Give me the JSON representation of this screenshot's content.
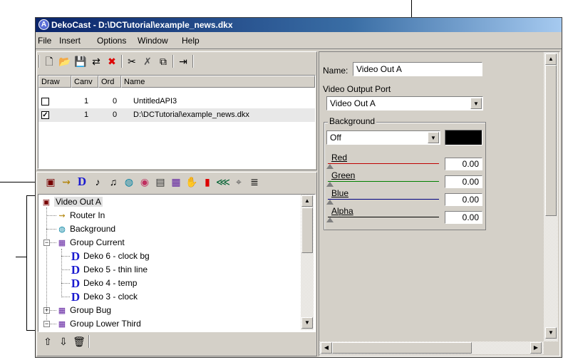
{
  "window": {
    "title": "DekoCast - D:\\DCTutorial\\example_news.dkx",
    "app_icon": "A"
  },
  "menu": {
    "items": [
      "File",
      "Insert",
      "Options",
      "Window",
      "Help"
    ]
  },
  "toolbar": {
    "icons": [
      "new-icon",
      "open-icon",
      "save-icon",
      "save-all-icon",
      "close-icon",
      "cut-icon",
      "delete-icon",
      "copy-icon",
      "export-icon"
    ],
    "glyphs": [
      "🗋",
      "📂",
      "💾",
      "⇄",
      "✖",
      "✂",
      "✗",
      "⧉",
      "⇥"
    ]
  },
  "canvas_list": {
    "headers": [
      "Draw",
      "Canv",
      "Ord",
      "Name"
    ],
    "rows": [
      {
        "draw": "",
        "canv": "1",
        "ord": "0",
        "name": "UntitledAPI3"
      },
      {
        "draw": "✓",
        "canv": "1",
        "ord": "0",
        "name": "D:\\DCTutorial\\example_news.dkx"
      }
    ]
  },
  "node_toolbar": {
    "icons": [
      "video-out-icon",
      "router-in-icon",
      "deko-icon",
      "audio-icon",
      "audio-2-icon",
      "background-icon",
      "color-icon",
      "image-icon",
      "group-icon",
      "hand-icon",
      "marker-icon",
      "wipe-icon",
      "pointer-icon",
      "text-icon"
    ],
    "glyphs": [
      "▣",
      "⇝",
      "D",
      "♪",
      "♫",
      "◍",
      "◉",
      "▤",
      "▦",
      "✋",
      "▮",
      "⋘",
      "⌖",
      "≣"
    ]
  },
  "tree": {
    "nodes": [
      {
        "label": "Video Out A",
        "level": 0,
        "icon": "video-out-icon",
        "glyph": "▣",
        "expander": ""
      },
      {
        "label": "Router In",
        "level": 1,
        "icon": "router-in-icon",
        "glyph": "⇝",
        "expander": ""
      },
      {
        "label": "Background",
        "level": 1,
        "icon": "background-icon",
        "glyph": "◍",
        "expander": ""
      },
      {
        "label": "Group Current",
        "level": 1,
        "icon": "group-icon",
        "glyph": "▦",
        "expander": "−"
      },
      {
        "label": "Deko 6 - clock bg",
        "level": 2,
        "icon": "deko-icon",
        "glyph": "D",
        "expander": ""
      },
      {
        "label": "Deko 5 - thin line",
        "level": 2,
        "icon": "deko-icon",
        "glyph": "D",
        "expander": ""
      },
      {
        "label": "Deko 4 - temp",
        "level": 2,
        "icon": "deko-icon",
        "glyph": "D",
        "expander": ""
      },
      {
        "label": "Deko 3 - clock",
        "level": 2,
        "icon": "deko-icon",
        "glyph": "D",
        "expander": ""
      },
      {
        "label": "Group Bug",
        "level": 1,
        "icon": "group-icon",
        "glyph": "▦",
        "expander": "+"
      },
      {
        "label": "Group Lower Third",
        "level": 1,
        "icon": "group-icon",
        "glyph": "▦",
        "expander": "−"
      }
    ]
  },
  "bottom_toolbar": {
    "icons": [
      "move-up-icon",
      "move-down-icon",
      "trash-icon"
    ],
    "glyphs": [
      "⇧",
      "⇩",
      "🗑"
    ]
  },
  "properties": {
    "name_label": "Name:",
    "name_value": "Video Out A",
    "port_label": "Video Output Port",
    "port_value": "Video Out A",
    "background_group": "Background",
    "background_value": "Off",
    "background_color": "#000000",
    "channels": [
      {
        "label": "Red",
        "value": "0.00",
        "color": "#c00000"
      },
      {
        "label": "Green",
        "value": "0.00",
        "color": "#008000"
      },
      {
        "label": "Blue",
        "value": "0.00",
        "color": "#000080"
      },
      {
        "label": "Alpha",
        "value": "0.00",
        "color": "#000000"
      }
    ]
  }
}
